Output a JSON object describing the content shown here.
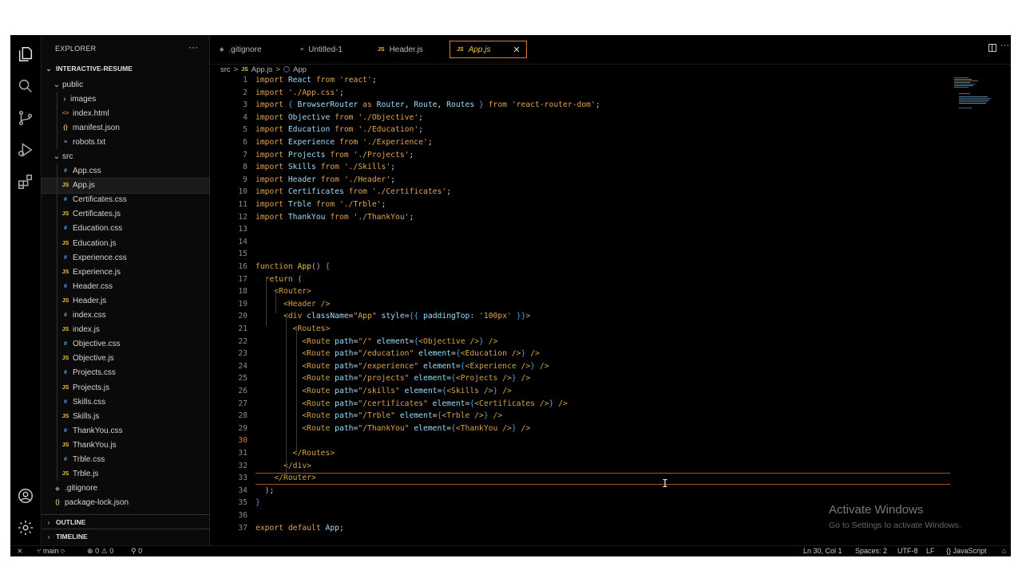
{
  "explorer": {
    "title": "EXPLORER",
    "more": "···",
    "project": "INTERACTIVE-RESUME",
    "tree": [
      {
        "label": "public",
        "kind": "folder-open",
        "depth": 1
      },
      {
        "label": "images",
        "kind": "folder",
        "depth": 2
      },
      {
        "label": "index.html",
        "kind": "html",
        "icon": "<>",
        "depth": 2
      },
      {
        "label": "manifest.json",
        "kind": "json",
        "icon": "{}",
        "depth": 2
      },
      {
        "label": "robots.txt",
        "kind": "txt",
        "icon": "≡",
        "depth": 2
      },
      {
        "label": "src",
        "kind": "folder-open",
        "depth": 1
      },
      {
        "label": "App.css",
        "kind": "css",
        "icon": "#",
        "depth": 2
      },
      {
        "label": "App.js",
        "kind": "js",
        "icon": "JS",
        "depth": 2,
        "selected": true
      },
      {
        "label": "Certificates.css",
        "kind": "css",
        "icon": "#",
        "depth": 2
      },
      {
        "label": "Certificates.js",
        "kind": "js",
        "icon": "JS",
        "depth": 2
      },
      {
        "label": "Education.css",
        "kind": "css",
        "icon": "#",
        "depth": 2
      },
      {
        "label": "Education.js",
        "kind": "js",
        "icon": "JS",
        "depth": 2
      },
      {
        "label": "Experience.css",
        "kind": "css",
        "icon": "#",
        "depth": 2
      },
      {
        "label": "Experience.js",
        "kind": "js",
        "icon": "JS",
        "depth": 2
      },
      {
        "label": "Header.css",
        "kind": "css",
        "icon": "#",
        "depth": 2
      },
      {
        "label": "Header.js",
        "kind": "js",
        "icon": "JS",
        "depth": 2
      },
      {
        "label": "index.css",
        "kind": "css",
        "icon": "#",
        "depth": 2
      },
      {
        "label": "index.js",
        "kind": "js",
        "icon": "JS",
        "depth": 2
      },
      {
        "label": "Objective.css",
        "kind": "css",
        "icon": "#",
        "depth": 2
      },
      {
        "label": "Objective.js",
        "kind": "js",
        "icon": "JS",
        "depth": 2
      },
      {
        "label": "Projects.css",
        "kind": "css",
        "icon": "#",
        "depth": 2
      },
      {
        "label": "Projects.js",
        "kind": "js",
        "icon": "JS",
        "depth": 2
      },
      {
        "label": "Skills.css",
        "kind": "css",
        "icon": "#",
        "depth": 2
      },
      {
        "label": "Skills.js",
        "kind": "js",
        "icon": "JS",
        "depth": 2
      },
      {
        "label": "ThankYou.css",
        "kind": "css",
        "icon": "#",
        "depth": 2
      },
      {
        "label": "ThankYou.js",
        "kind": "js",
        "icon": "JS",
        "depth": 2
      },
      {
        "label": "Trble.css",
        "kind": "css",
        "icon": "#",
        "depth": 2
      },
      {
        "label": "Trble.js",
        "kind": "js",
        "icon": "JS",
        "depth": 2
      },
      {
        "label": ".gitignore",
        "kind": "git",
        "icon": "◈",
        "depth": 1
      },
      {
        "label": "package-lock.json",
        "kind": "json",
        "icon": "{}",
        "depth": 1
      }
    ],
    "outline": "OUTLINE",
    "timeline": "TIMELINE"
  },
  "tabs": [
    {
      "label": ".gitignore",
      "icon": "◈",
      "kind": "git"
    },
    {
      "label": "Untitled-1",
      "icon": "≡",
      "kind": "txt"
    },
    {
      "label": "Header.js",
      "icon": "JS",
      "kind": "js"
    },
    {
      "label": "App.js",
      "icon": "JS",
      "kind": "js",
      "active": true,
      "close": "✕"
    }
  ],
  "breadcrumb": {
    "folder": "src",
    "sep": ">",
    "file": "App.js",
    "symbol": "App"
  },
  "code_lines": [
    [
      [
        "kw",
        "import "
      ],
      [
        "id",
        "React "
      ],
      [
        "kw",
        "from "
      ],
      [
        "str",
        "'react'"
      ],
      [
        "pun",
        ";"
      ]
    ],
    [
      [
        "kw",
        "import "
      ],
      [
        "str",
        "'./App.css'"
      ],
      [
        "pun",
        ";"
      ]
    ],
    [
      [
        "kw",
        "import "
      ],
      [
        "brk",
        "{ "
      ],
      [
        "id",
        "BrowserRouter "
      ],
      [
        "kw",
        "as "
      ],
      [
        "id",
        "Router"
      ],
      [
        "pun",
        ", "
      ],
      [
        "id",
        "Route"
      ],
      [
        "pun",
        ", "
      ],
      [
        "id",
        "Routes "
      ],
      [
        "brk",
        "} "
      ],
      [
        "kw",
        "from "
      ],
      [
        "str",
        "'react-router-dom'"
      ],
      [
        "pun",
        ";"
      ]
    ],
    [
      [
        "kw",
        "import "
      ],
      [
        "id",
        "Objective "
      ],
      [
        "kw",
        "from "
      ],
      [
        "str",
        "'./Objective'"
      ],
      [
        "pun",
        ";"
      ]
    ],
    [
      [
        "kw",
        "import "
      ],
      [
        "id",
        "Education "
      ],
      [
        "kw",
        "from "
      ],
      [
        "str",
        "'./Education'"
      ],
      [
        "pun",
        ";"
      ]
    ],
    [
      [
        "kw",
        "import "
      ],
      [
        "id",
        "Experience "
      ],
      [
        "kw",
        "from "
      ],
      [
        "str",
        "'./Experience'"
      ],
      [
        "pun",
        ";"
      ]
    ],
    [
      [
        "kw",
        "import "
      ],
      [
        "id",
        "Projects "
      ],
      [
        "kw",
        "from "
      ],
      [
        "str",
        "'./Projects'"
      ],
      [
        "pun",
        ";"
      ]
    ],
    [
      [
        "kw",
        "import "
      ],
      [
        "id",
        "Skills "
      ],
      [
        "kw",
        "from "
      ],
      [
        "str",
        "'./Skills'"
      ],
      [
        "pun",
        ";"
      ]
    ],
    [
      [
        "kw",
        "import "
      ],
      [
        "id",
        "Header "
      ],
      [
        "kw",
        "from "
      ],
      [
        "str",
        "'./Header'"
      ],
      [
        "pun",
        ";"
      ]
    ],
    [
      [
        "kw",
        "import "
      ],
      [
        "id",
        "Certificates "
      ],
      [
        "kw",
        "from "
      ],
      [
        "str",
        "'./Certificates'"
      ],
      [
        "pun",
        ";"
      ]
    ],
    [
      [
        "kw",
        "import "
      ],
      [
        "id",
        "Trble "
      ],
      [
        "kw",
        "from "
      ],
      [
        "str",
        "'./Trble'"
      ],
      [
        "pun",
        ";"
      ]
    ],
    [
      [
        "kw",
        "import "
      ],
      [
        "id",
        "ThankYou "
      ],
      [
        "kw",
        "from "
      ],
      [
        "str",
        "'./ThankYou'"
      ],
      [
        "pun",
        ";"
      ]
    ],
    [],
    [],
    [],
    [
      [
        "kw",
        "function "
      ],
      [
        "fn",
        "App"
      ],
      [
        "brk2",
        "() "
      ],
      [
        "brk",
        "{"
      ]
    ],
    [
      [
        "pun",
        "  "
      ],
      [
        "kw",
        "return "
      ],
      [
        "brk2",
        "("
      ]
    ],
    [
      [
        "pun",
        "    "
      ],
      [
        "tag",
        "<Router>"
      ]
    ],
    [
      [
        "pun",
        "      "
      ],
      [
        "tag",
        "<Header />"
      ]
    ],
    [
      [
        "pun",
        "      "
      ],
      [
        "tag",
        "<div "
      ],
      [
        "attr",
        "className"
      ],
      [
        "pun",
        "="
      ],
      [
        "str",
        "\"App\" "
      ],
      [
        "attr",
        "style"
      ],
      [
        "pun",
        "="
      ],
      [
        "brk",
        "{{ "
      ],
      [
        "attr",
        "paddingTop"
      ],
      [
        "pun",
        ": "
      ],
      [
        "str",
        "'100px' "
      ],
      [
        "brk",
        "}}"
      ],
      [
        "tag",
        ">"
      ]
    ],
    [
      [
        "pun",
        "        "
      ],
      [
        "tag",
        "<Routes>"
      ]
    ],
    [
      [
        "pun",
        "          "
      ],
      [
        "tag",
        "<Route "
      ],
      [
        "attr",
        "path"
      ],
      [
        "pun",
        "="
      ],
      [
        "str",
        "\"/\" "
      ],
      [
        "attr",
        "element"
      ],
      [
        "pun",
        "="
      ],
      [
        "brk",
        "{"
      ],
      [
        "tag",
        "<Objective />"
      ],
      [
        "brk",
        "} "
      ],
      [
        "tag",
        "/>"
      ]
    ],
    [
      [
        "pun",
        "          "
      ],
      [
        "tag",
        "<Route "
      ],
      [
        "attr",
        "path"
      ],
      [
        "pun",
        "="
      ],
      [
        "str",
        "\"/education\" "
      ],
      [
        "attr",
        "element"
      ],
      [
        "pun",
        "="
      ],
      [
        "brk",
        "{"
      ],
      [
        "tag",
        "<Education />"
      ],
      [
        "brk",
        "} "
      ],
      [
        "tag",
        "/>"
      ]
    ],
    [
      [
        "pun",
        "          "
      ],
      [
        "tag",
        "<Route "
      ],
      [
        "attr",
        "path"
      ],
      [
        "pun",
        "="
      ],
      [
        "str",
        "\"/experience\" "
      ],
      [
        "attr",
        "element"
      ],
      [
        "pun",
        "="
      ],
      [
        "brk",
        "{"
      ],
      [
        "tag",
        "<Experience />"
      ],
      [
        "brk",
        "} "
      ],
      [
        "tag",
        "/>"
      ]
    ],
    [
      [
        "pun",
        "          "
      ],
      [
        "tag",
        "<Route "
      ],
      [
        "attr",
        "path"
      ],
      [
        "pun",
        "="
      ],
      [
        "str",
        "\"/projects\" "
      ],
      [
        "attr",
        "element"
      ],
      [
        "pun",
        "="
      ],
      [
        "brk",
        "{"
      ],
      [
        "tag",
        "<Projects />"
      ],
      [
        "brk",
        "} "
      ],
      [
        "tag",
        "/>"
      ]
    ],
    [
      [
        "pun",
        "          "
      ],
      [
        "tag",
        "<Route "
      ],
      [
        "attr",
        "path"
      ],
      [
        "pun",
        "="
      ],
      [
        "str",
        "\"/skills\" "
      ],
      [
        "attr",
        "element"
      ],
      [
        "pun",
        "="
      ],
      [
        "brk",
        "{"
      ],
      [
        "tag",
        "<Skills />"
      ],
      [
        "brk",
        "} "
      ],
      [
        "tag",
        "/>"
      ]
    ],
    [
      [
        "pun",
        "          "
      ],
      [
        "tag",
        "<Route "
      ],
      [
        "attr",
        "path"
      ],
      [
        "pun",
        "="
      ],
      [
        "str",
        "\"/certificates\" "
      ],
      [
        "attr",
        "element"
      ],
      [
        "pun",
        "="
      ],
      [
        "brk",
        "{"
      ],
      [
        "tag",
        "<Certificates />"
      ],
      [
        "brk",
        "} "
      ],
      [
        "tag",
        "/>"
      ]
    ],
    [
      [
        "pun",
        "          "
      ],
      [
        "tag",
        "<Route "
      ],
      [
        "attr",
        "path"
      ],
      [
        "pun",
        "="
      ],
      [
        "str",
        "\"/Trble\" "
      ],
      [
        "attr",
        "element"
      ],
      [
        "pun",
        "="
      ],
      [
        "brk",
        "{"
      ],
      [
        "tag",
        "<Trble />"
      ],
      [
        "brk",
        "} "
      ],
      [
        "tag",
        "/>"
      ]
    ],
    [
      [
        "pun",
        "          "
      ],
      [
        "tag",
        "<Route "
      ],
      [
        "attr",
        "path"
      ],
      [
        "pun",
        "="
      ],
      [
        "str",
        "\"/ThankYou\" "
      ],
      [
        "attr",
        "element"
      ],
      [
        "pun",
        "="
      ],
      [
        "brk",
        "{"
      ],
      [
        "tag",
        "<ThankYou />"
      ],
      [
        "brk",
        "} "
      ],
      [
        "tag",
        "/>"
      ]
    ],
    [],
    [
      [
        "pun",
        "        "
      ],
      [
        "tag",
        "</Routes>"
      ]
    ],
    [
      [
        "pun",
        "      "
      ],
      [
        "tag",
        "</div>"
      ]
    ],
    [
      [
        "pun",
        "    "
      ],
      [
        "tag",
        "</Router>"
      ]
    ],
    [
      [
        "pun",
        "  "
      ],
      [
        "brk2",
        ")"
      ],
      [
        "pun",
        ";"
      ]
    ],
    [
      [
        "brk",
        "}"
      ]
    ],
    [],
    [
      [
        "kw",
        "export default "
      ],
      [
        "id",
        "App"
      ],
      [
        "pun",
        ";"
      ]
    ]
  ],
  "current_line": 30,
  "watermark": {
    "title": "Activate Windows",
    "subtitle": "Go to Settings to activate Windows."
  },
  "status": {
    "branch": "main",
    "errors": "0",
    "warnings": "0",
    "ports": "0",
    "position": "Ln 30, Col 1",
    "spaces": "Spaces: 2",
    "encoding": "UTF-8",
    "eol": "LF",
    "language": "JavaScript"
  },
  "colors": {
    "accent": "#e37933",
    "js": "#e8c547",
    "css": "#5aa9e6",
    "background": "#000000"
  }
}
